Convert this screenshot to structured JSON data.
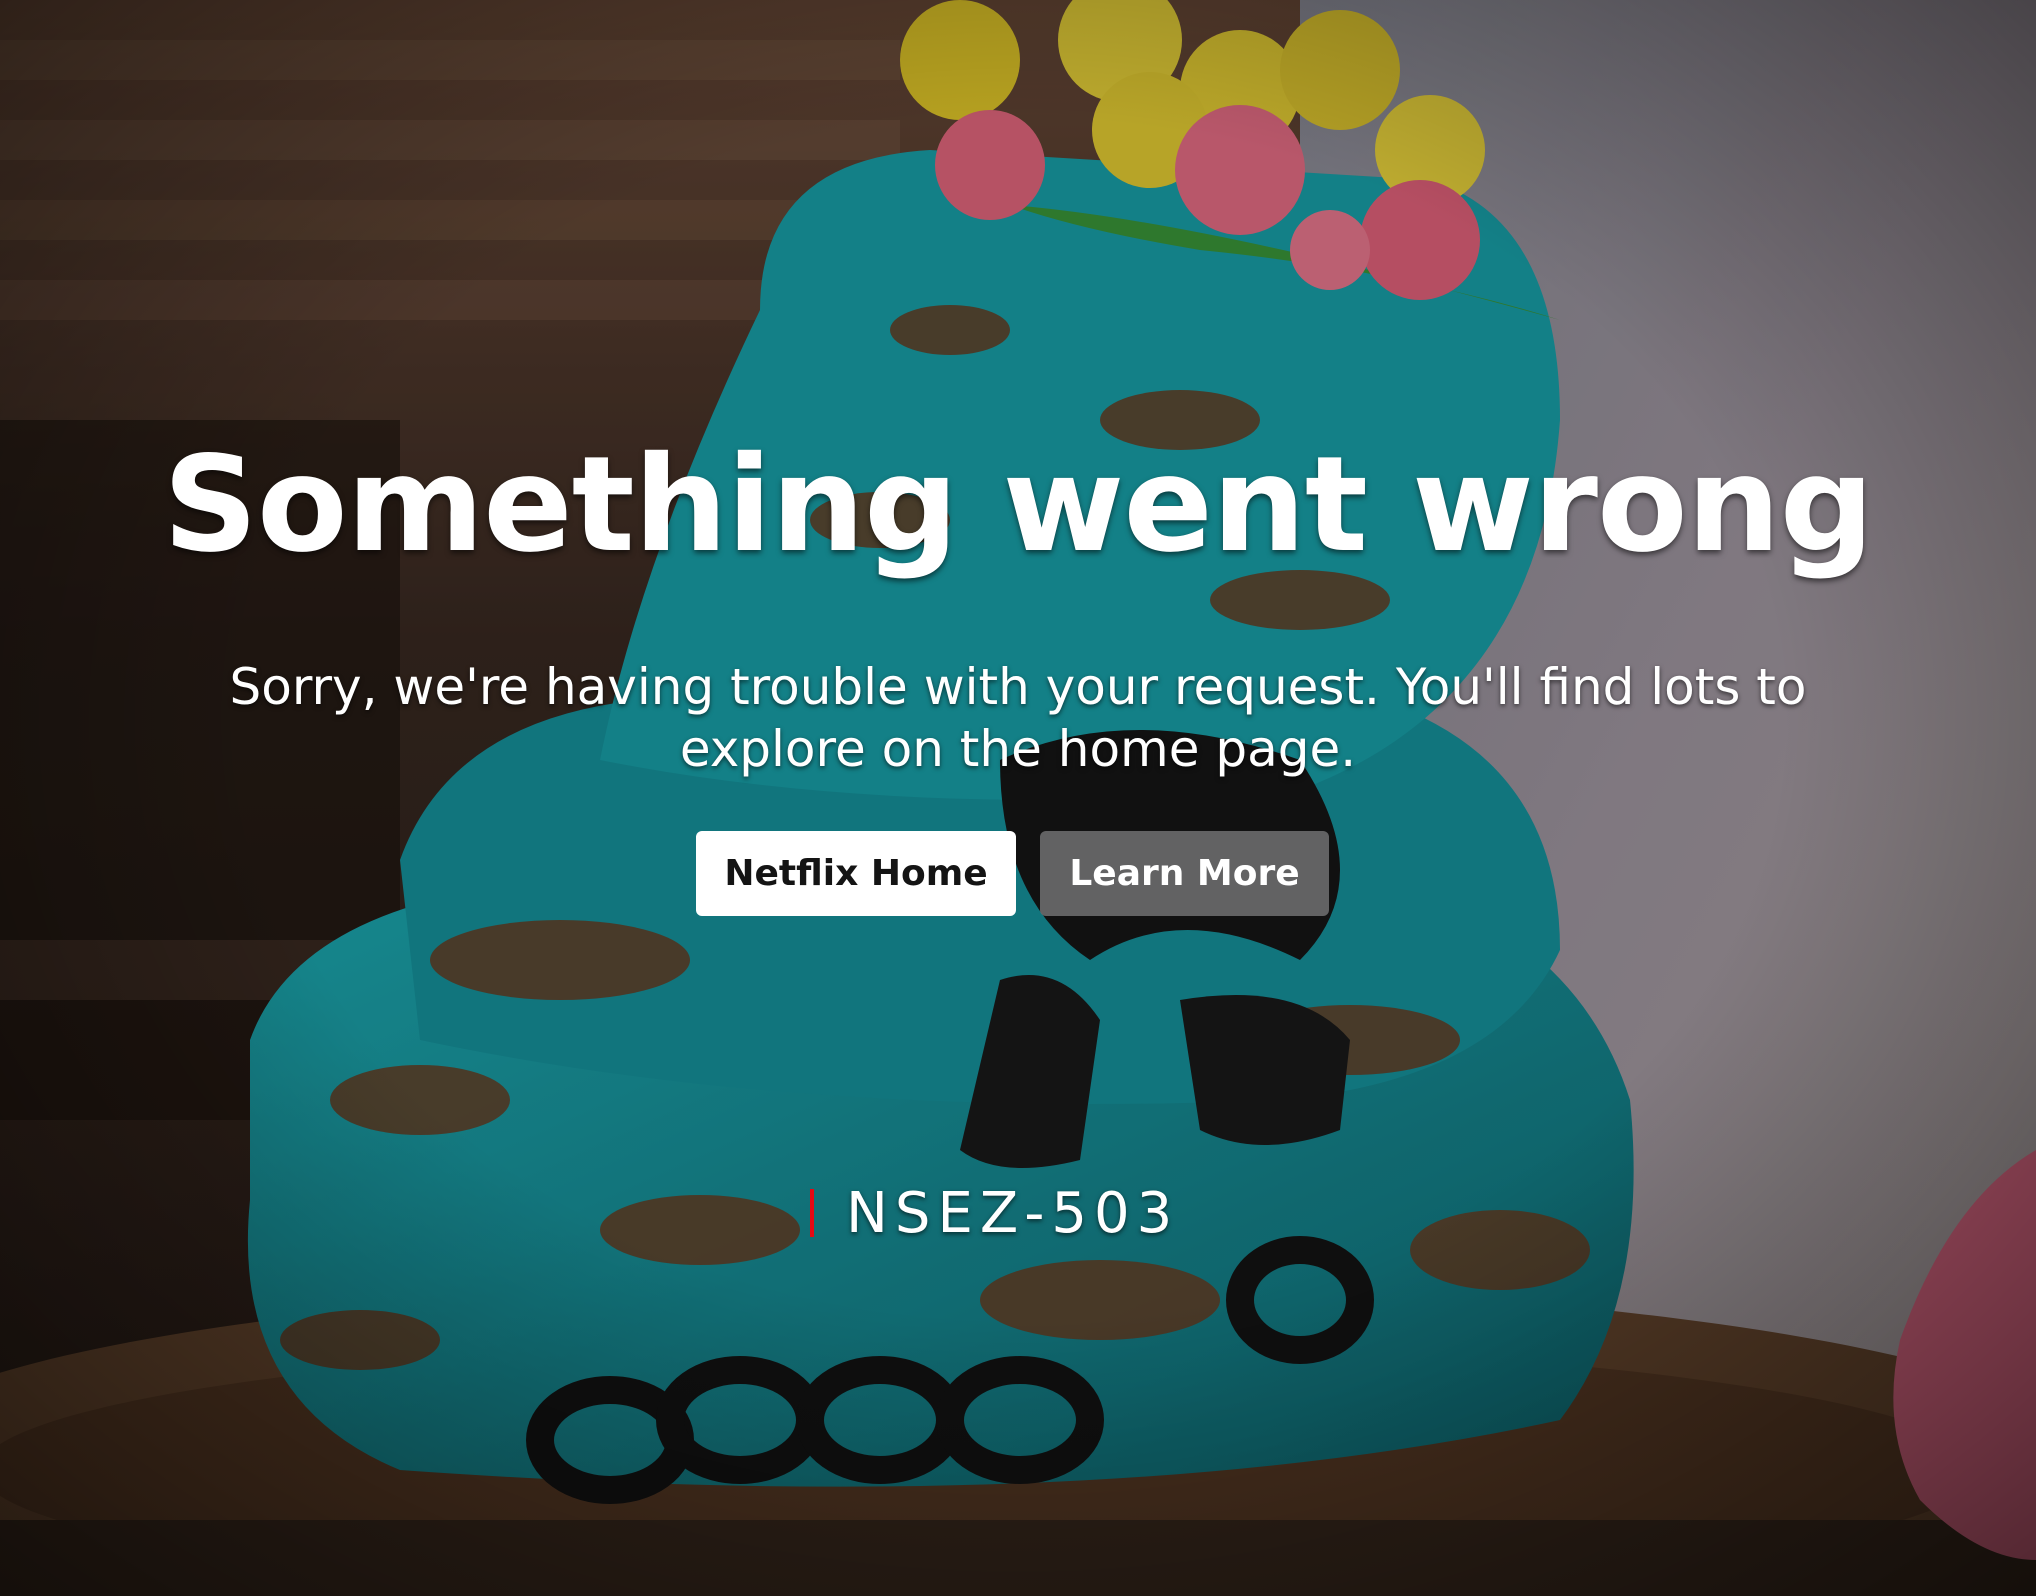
{
  "page": {
    "title": "Something went wrong",
    "message": "Sorry, we're having trouble with your request. You'll find lots to explore on the home page.",
    "buttons": {
      "home_label": "Netflix Home",
      "learn_label": "Learn More"
    },
    "error_code": "NSEZ-503"
  },
  "colors": {
    "accent_red": "#e50914",
    "button_primary_bg": "#ffffff",
    "button_secondary_bg": "#6d6d6e",
    "frosting_teal": "#1aa0a8"
  }
}
